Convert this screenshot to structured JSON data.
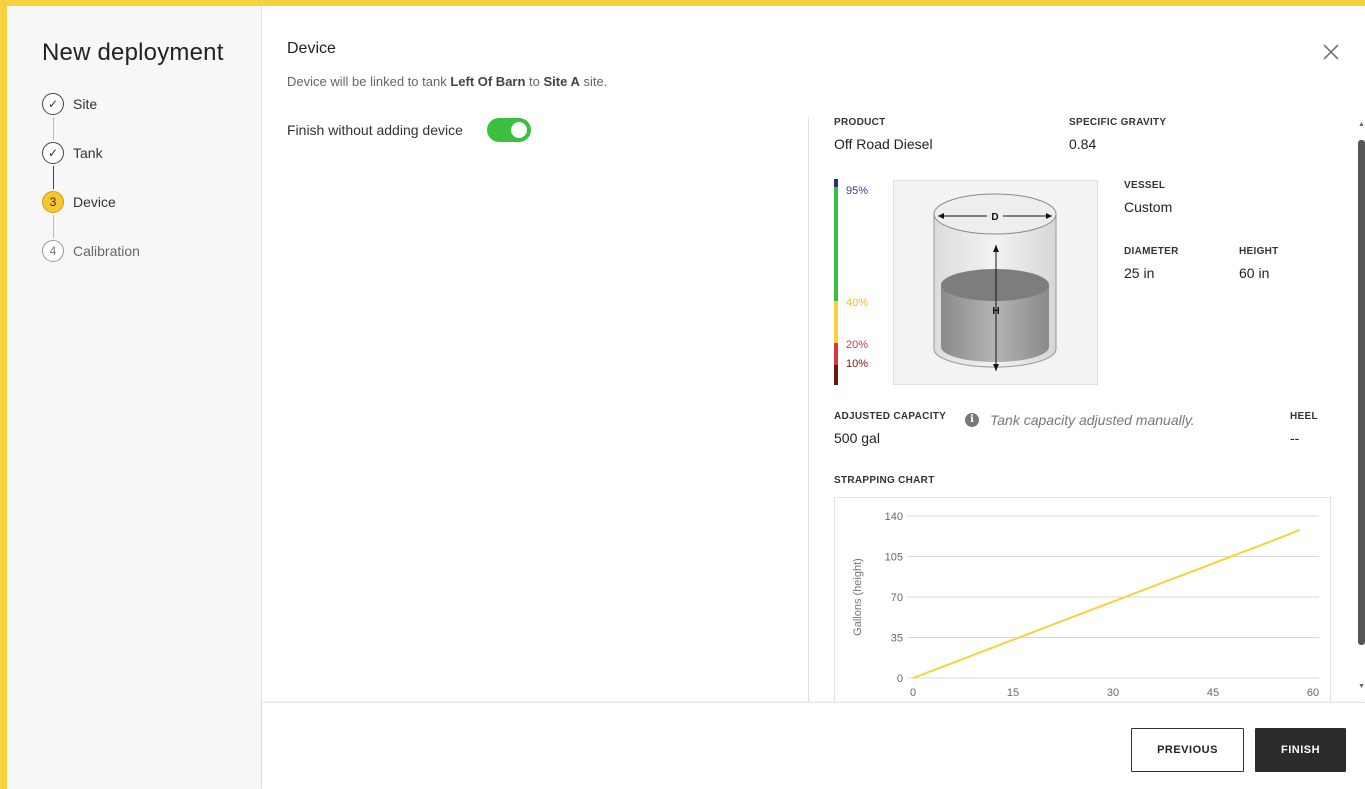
{
  "sidebar": {
    "title": "New deployment",
    "steps": [
      {
        "label": "Site",
        "marker": "✓",
        "state": "done"
      },
      {
        "label": "Tank",
        "marker": "✓",
        "state": "done"
      },
      {
        "label": "Device",
        "marker": "3",
        "state": "active"
      },
      {
        "label": "Calibration",
        "marker": "4",
        "state": "future"
      }
    ]
  },
  "header": {
    "title": "Device",
    "subtitle_prefix": "Device will be linked to tank ",
    "tank_name": "Left Of Barn",
    "subtitle_mid": " to ",
    "site_name": "Site A",
    "subtitle_suffix": " site."
  },
  "toggle": {
    "label": "Finish without adding device",
    "on": true
  },
  "details": {
    "product_label": "PRODUCT",
    "product_value": "Off Road Diesel",
    "gravity_label": "SPECIFIC GRAVITY",
    "gravity_value": "0.84",
    "vessel_label": "VESSEL",
    "vessel_value": "Custom",
    "diameter_label": "DIAMETER",
    "diameter_value": "25 in",
    "height_label": "HEIGHT",
    "height_value": "60 in",
    "capacity_label": "ADJUSTED CAPACITY",
    "capacity_value": "500 gal",
    "capacity_note": "Tank capacity adjusted manually.",
    "heel_label": "HEEL",
    "heel_value": "--",
    "info_glyph": "i",
    "tank_d_label": "D",
    "tank_h_label": "H"
  },
  "levels": [
    {
      "label": "95%",
      "value": 95,
      "color": "#3b3b8f"
    },
    {
      "label": "40%",
      "value": 40,
      "color": "#f6c62a"
    },
    {
      "label": "20%",
      "value": 20,
      "color": "#d9383a"
    },
    {
      "label": "10%",
      "value": 10,
      "color": "#6b1a12"
    }
  ],
  "level_bar_colors": {
    "top": "#2a2f7a",
    "green": "#3bbf3f",
    "yellow": "#f6d23c",
    "red": "#d9383a",
    "dark": "#6b1a12"
  },
  "strapping_chart_label": "STRAPPING CHART",
  "chart_data": {
    "type": "line",
    "title": "",
    "xlabel": "",
    "ylabel": "Gallons (height)",
    "x_ticks": [
      "0",
      "15",
      "30",
      "45",
      "60"
    ],
    "y_ticks": [
      "0",
      "35",
      "70",
      "105",
      "140"
    ],
    "xlim": [
      0,
      60
    ],
    "ylim": [
      0,
      140
    ],
    "series": [
      {
        "color": "#f6d23c",
        "x": [
          0,
          5,
          10,
          15,
          20,
          25,
          30,
          35,
          40,
          45,
          50,
          55,
          58
        ],
        "y": [
          0,
          11,
          22,
          33,
          44,
          55,
          66,
          77,
          88,
          99,
          110,
          121,
          128
        ]
      }
    ],
    "grid": true
  },
  "footer": {
    "previous_label": "PREVIOUS",
    "finish_label": "FINISH"
  },
  "colors": {
    "accent": "#f6d23c",
    "toggle_on": "#3bbf3f",
    "primary_button": "#2b2b2b"
  }
}
